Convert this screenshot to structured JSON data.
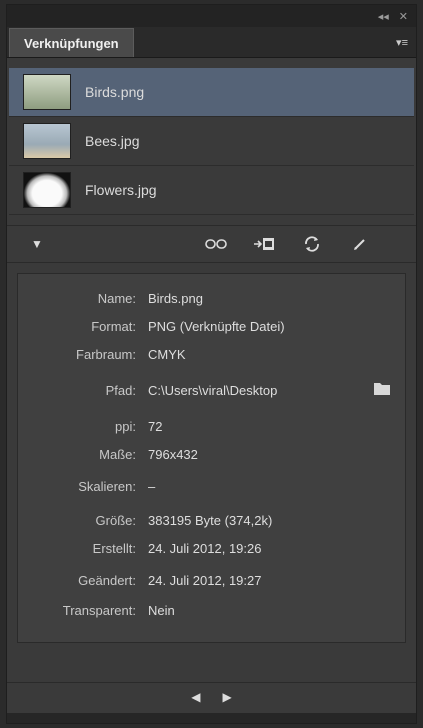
{
  "topbar": {
    "collapse": "◂◂",
    "close": "✕"
  },
  "panel": {
    "tab_label": "Verknüpfungen",
    "menu_glyph": "▾≡"
  },
  "links": [
    {
      "name": "Birds.png",
      "thumb": "birds",
      "selected": true
    },
    {
      "name": "Bees.jpg",
      "thumb": "bees",
      "selected": false
    },
    {
      "name": "Flowers.jpg",
      "thumb": "flowers",
      "selected": false
    }
  ],
  "toolbar": {
    "disclose_glyph": "▼",
    "icons": [
      "relink-icon",
      "goto-link-icon",
      "update-link-icon",
      "edit-original-icon"
    ]
  },
  "info": {
    "name_label": "Name:",
    "name_value": "Birds.png",
    "format_label": "Format:",
    "format_value": "PNG (Verknüpfte Datei)",
    "colorspace_label": "Farbraum:",
    "colorspace_value": "CMYK",
    "path_label": "Pfad:",
    "path_value": "C:\\Users\\viral\\Desktop",
    "ppi_label": "ppi:",
    "ppi_value": "72",
    "dimensions_label": "Maße:",
    "dimensions_value": "796x432",
    "scale_label": "Skalieren:",
    "scale_value": "–",
    "size_label": "Größe:",
    "size_value": "383195 Byte  (374,2k)",
    "created_label": "Erstellt:",
    "created_value": "24. Juli 2012,  19:26",
    "modified_label": "Geändert:",
    "modified_value": "24. Juli 2012,  19:27",
    "transparent_label": "Transparent:",
    "transparent_value": "Nein"
  },
  "pager": {
    "prev": "◀",
    "next": "▶"
  }
}
